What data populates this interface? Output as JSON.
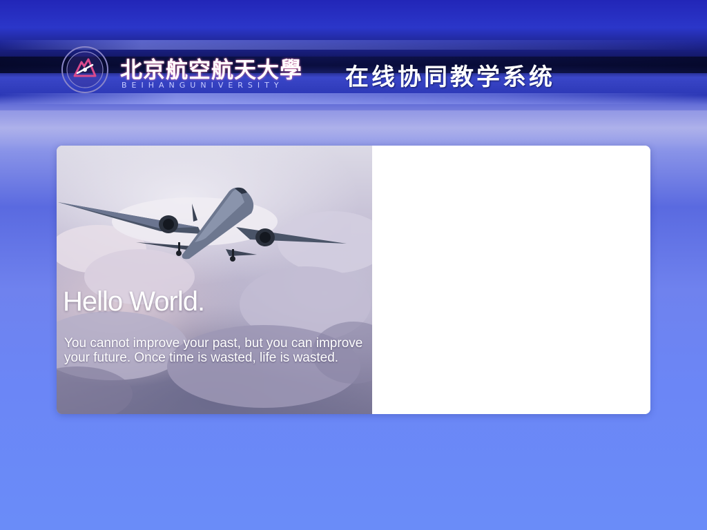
{
  "header": {
    "university_name_cn": "北京航空航天大學",
    "university_name_en": "BEIHANGUNIVERSITY",
    "system_title": "在线协同教学系统",
    "logo_icon": "university-seal-icon"
  },
  "hero": {
    "title": "Hello World.",
    "quote": "You cannot improve your past, but you can improve your future. Once time is wasted, life is wasted.",
    "image_subject": "airplane-in-clouds"
  },
  "colors": {
    "background_top": "#2226b8",
    "background_bottom": "#6a8cf8",
    "card_background": "#ffffff",
    "text_light": "#ffffff",
    "logo_accent": "#c02a6a"
  }
}
